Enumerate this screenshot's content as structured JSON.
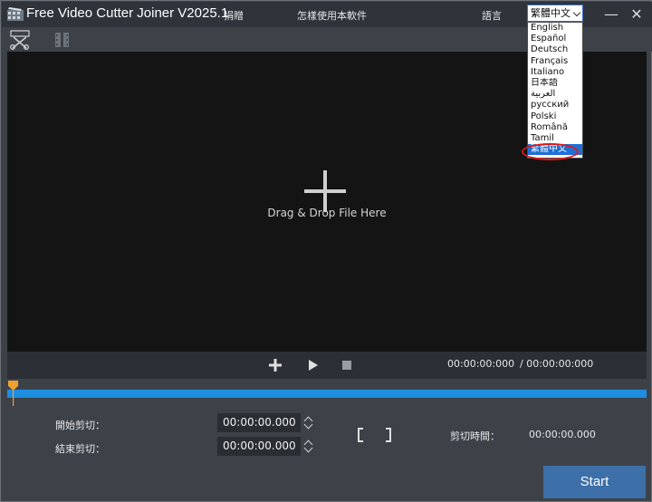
{
  "window": {
    "title": "Free Video Cutter Joiner V2025.1",
    "donate_label": "捐贈",
    "howto_label": "怎樣使用本軟件",
    "language_label": "語言",
    "minimize_glyph": "—",
    "close_glyph": "✕"
  },
  "language": {
    "selected": "繁體中文",
    "options": [
      "English",
      "Español",
      "Deutsch",
      "Français",
      "Italiano",
      "日本語",
      "العربية",
      "русский",
      "Polski",
      "Română",
      "Tamil",
      "繁體中文"
    ]
  },
  "toolbar": {
    "cut_icon": "scissors-icon",
    "join_icon": "film-join-icon"
  },
  "video": {
    "drop_label": "Drag & Drop File Here"
  },
  "player": {
    "current_time": "00:00:00:000",
    "total_time": "/ 00:00:00:000"
  },
  "cut": {
    "start_label": "開始剪切：",
    "end_label": "結束剪切：",
    "start_value": "00:00:00.000",
    "end_value": "00:00:00.000",
    "duration_label": "剪切時間：",
    "duration_value": "00:00:00.000"
  },
  "actions": {
    "start_label": "Start"
  },
  "colors": {
    "accent": "#1c8ddf",
    "start_button": "#3d6fa8",
    "playhead": "#f0a030",
    "highlight": "#d91b1b"
  }
}
